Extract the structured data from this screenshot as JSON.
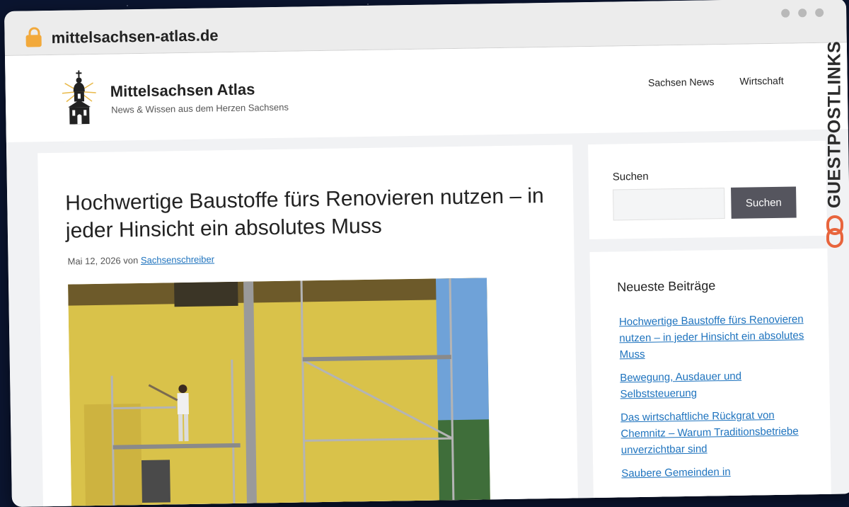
{
  "browser": {
    "url": "mittelsachsen-atlas.de"
  },
  "site": {
    "title": "Mittelsachsen Atlas",
    "tagline": "News & Wissen aus dem Herzen Sachsens",
    "nav": [
      "Sachsen News",
      "Wirtschaft"
    ]
  },
  "article": {
    "title": "Hochwertige Baustoffe fürs Renovieren nutzen – in jeder Hinsicht ein absolutes Muss",
    "date": "Mai 12, 2026",
    "by": "von",
    "author": "Sachsenschreiber"
  },
  "sidebar": {
    "search_label": "Suchen",
    "search_button": "Suchen",
    "recent_title": "Neueste Beiträge",
    "recent_posts": [
      "Hochwertige Baustoffe fürs Renovieren nutzen – in jeder Hinsicht ein absolutes Muss",
      "Bewegung, Ausdauer und Selbststeuerung",
      "Das wirtschaftliche Rückgrat von Chemnitz – Warum Traditionsbetriebe unverzichtbar sind",
      "Saubere Gemeinden in"
    ]
  },
  "badge": {
    "text": "GUESTPOSTLINKS",
    "accent": "#e8643c"
  },
  "colors": {
    "link": "#1e73be",
    "button": "#55555e",
    "facade": "#d9c24a"
  }
}
